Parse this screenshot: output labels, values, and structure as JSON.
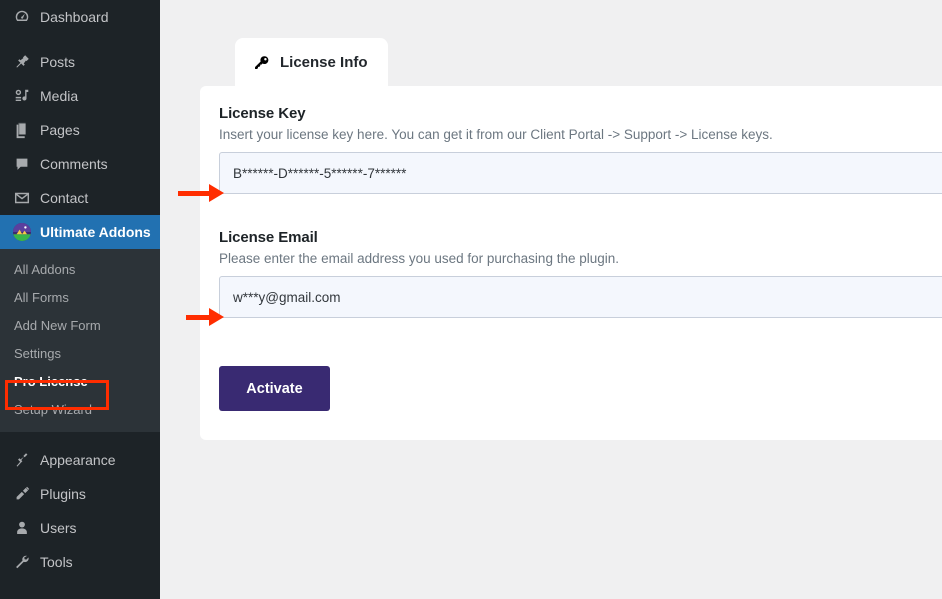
{
  "sidebar": {
    "top_items": [
      {
        "label": "Dashboard",
        "icon": "dashboard-icon",
        "current": false
      },
      {
        "label": "Posts",
        "icon": "pin-icon",
        "current": false
      },
      {
        "label": "Media",
        "icon": "media-icon",
        "current": false
      },
      {
        "label": "Pages",
        "icon": "pages-icon",
        "current": false
      },
      {
        "label": "Comments",
        "icon": "comment-icon",
        "current": false
      },
      {
        "label": "Contact",
        "icon": "email-icon",
        "current": false
      },
      {
        "label": "Ultimate Addons",
        "icon": "ultimate-addons-logo-icon",
        "current": true
      }
    ],
    "submenu": [
      {
        "label": "All Addons",
        "current": false
      },
      {
        "label": "All Forms",
        "current": false
      },
      {
        "label": "Add New Form",
        "current": false
      },
      {
        "label": "Settings",
        "current": false
      },
      {
        "label": "Pro License",
        "current": true
      },
      {
        "label": "Setup Wizard",
        "current": false
      }
    ],
    "bottom_items": [
      {
        "label": "Appearance",
        "icon": "appearance-icon"
      },
      {
        "label": "Plugins",
        "icon": "plugins-icon"
      },
      {
        "label": "Users",
        "icon": "users-icon"
      },
      {
        "label": "Tools",
        "icon": "tools-icon"
      }
    ]
  },
  "tabs": [
    {
      "label": "License Info",
      "icon": "key-icon",
      "active": true
    }
  ],
  "license_form": {
    "key_field": {
      "label": "License Key",
      "description": "Insert your license key here. You can get it from our Client Portal -> Support -> License keys.",
      "value": "B******-D******-5******-7******",
      "placeholder": ""
    },
    "email_field": {
      "label": "License Email",
      "description": "Please enter the email address you used for purchasing the plugin.",
      "value": "w***y@gmail.com",
      "placeholder": ""
    },
    "activate_label": "Activate"
  },
  "colors": {
    "sidebar_bg": "#1d2327",
    "submenu_bg": "#2c3338",
    "active_menu_bg": "#2271b1",
    "page_bg": "#f0f0f1",
    "card_bg": "#ffffff",
    "input_bg": "#f4f7fd",
    "input_border": "#c8cfdb",
    "button_bg": "#392a72",
    "annotation_red": "#ff2d00"
  }
}
